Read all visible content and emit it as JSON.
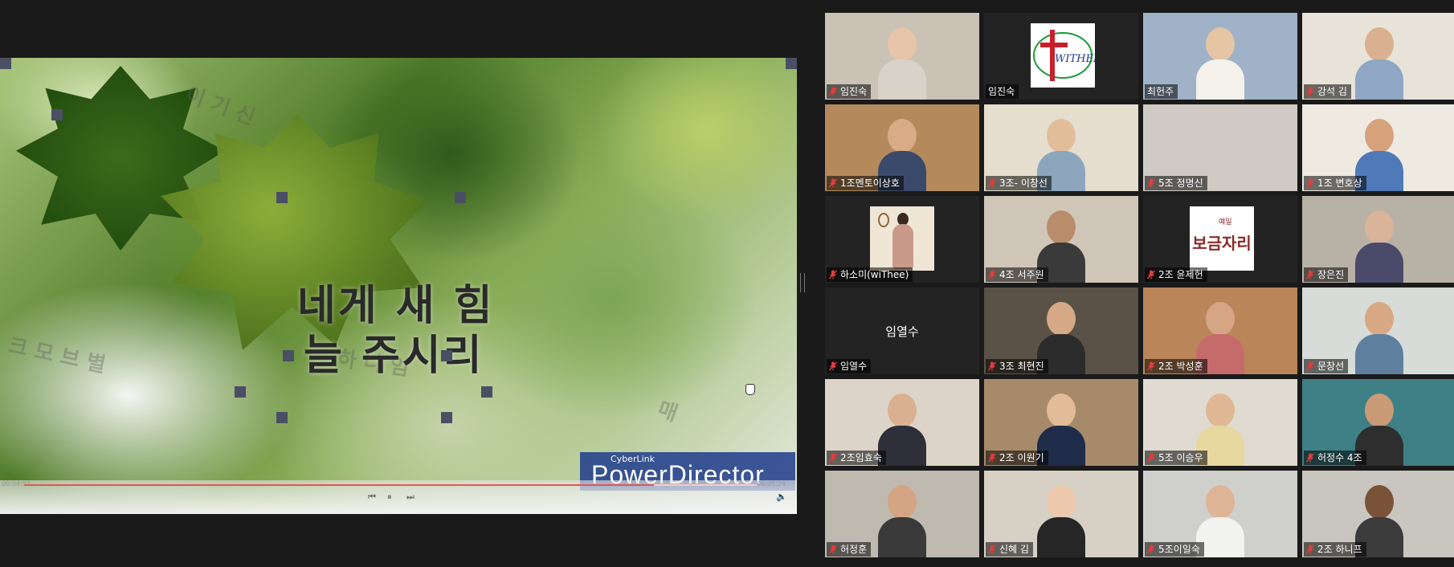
{
  "slide": {
    "title_line1": "네게 새 힘",
    "title_line2": "늘 주시리",
    "watermark_small": "CyberLink",
    "watermark_big": "PowerDirector",
    "player": {
      "progress": 0.86,
      "time_current": "00:04:57",
      "time_total": "00:05:24",
      "prev_icon": "⏮",
      "pause_icon": "⏸",
      "next_icon": "⏭",
      "volume_icon": "🔈"
    }
  },
  "colors": {
    "mute": "#e23c3c",
    "label_bg": "rgba(0,0,0,0.55)",
    "tile_bg": "#232323"
  },
  "participants": [
    {
      "name": "임진숙",
      "muted": true,
      "bg": "#c9c2b5",
      "skin": "#e8c4a8",
      "shirt": "#d9d2c8",
      "kind": "video"
    },
    {
      "name": "임진숙",
      "muted": false,
      "bg": "#232323",
      "kind": "logo-withee"
    },
    {
      "name": "최헌주",
      "muted": false,
      "bg": "#9fb2c8",
      "skin": "#e6c5a4",
      "shirt": "#f3f1ea",
      "kind": "video"
    },
    {
      "name": "강석 김",
      "muted": true,
      "bg": "#e7e3d8",
      "skin": "#d9b090",
      "shirt": "#8fa7c4",
      "kind": "video"
    },
    {
      "name": "1조멘토이상호",
      "muted": true,
      "bg": "#b48a5c",
      "skin": "#d9ab86",
      "shirt": "#3b4a6b",
      "kind": "video"
    },
    {
      "name": "3조- 이창선",
      "muted": true,
      "bg": "#e5ddcd",
      "skin": "#e2bd9a",
      "shirt": "#8da6bd",
      "kind": "video"
    },
    {
      "name": "5조 정명신",
      "muted": true,
      "bg": "#cfcbc4",
      "skin": "#cfcbc4",
      "shirt": "#cfcbc4",
      "kind": "video"
    },
    {
      "name": "1조 변호상",
      "muted": true,
      "bg": "#eeeae2",
      "skin": "#d5a27c",
      "shirt": "#4f79b8",
      "kind": "video"
    },
    {
      "name": "하소미(wiThee)",
      "muted": true,
      "bg": "#232323",
      "kind": "photo"
    },
    {
      "name": "4조 서주원",
      "muted": true,
      "bg": "#cfc6b8",
      "skin": "#b98d6c",
      "shirt": "#3a3a3a",
      "kind": "video"
    },
    {
      "name": "2조 윤제헌",
      "muted": true,
      "bg": "#232323",
      "kind": "logo-bogeum"
    },
    {
      "name": "장은진",
      "muted": true,
      "bg": "#b8b2a6",
      "skin": "#d9b49a",
      "shirt": "#4a4a6a",
      "kind": "video"
    },
    {
      "name": "임열수",
      "muted": true,
      "bg": "#232323",
      "kind": "text",
      "center": "임열수"
    },
    {
      "name": "3조 최현진",
      "muted": true,
      "bg": "#5a5246",
      "skin": "#d6a987",
      "shirt": "#2c2c2c",
      "kind": "video"
    },
    {
      "name": "2조 박성훈",
      "muted": true,
      "bg": "#b98559",
      "skin": "#d6a583",
      "shirt": "#c56b6b",
      "kind": "video"
    },
    {
      "name": "문창선",
      "muted": true,
      "bg": "#d8dcd8",
      "skin": "#d9a884",
      "shirt": "#5f7f9e",
      "kind": "video"
    },
    {
      "name": "2조임효숙",
      "muted": true,
      "bg": "#dcd4c8",
      "skin": "#d9b090",
      "shirt": "#2f2f3a",
      "kind": "video"
    },
    {
      "name": "2조 이원기",
      "muted": true,
      "bg": "#a68a6a",
      "skin": "#e2bb98",
      "shirt": "#1f2c4a",
      "kind": "video"
    },
    {
      "name": "5조 이승우",
      "muted": true,
      "bg": "#e0dbd0",
      "skin": "#e0b896",
      "shirt": "#e7d8a0",
      "kind": "video"
    },
    {
      "name": "허정수 4조",
      "muted": true,
      "bg": "#3f7f86",
      "skin": "#c99a76",
      "shirt": "#2e2e2e",
      "kind": "video"
    },
    {
      "name": "허정훈",
      "muted": true,
      "bg": "#bfbab0",
      "skin": "#d3a583",
      "shirt": "#3a3a3a",
      "kind": "video"
    },
    {
      "name": "신혜 김",
      "muted": true,
      "bg": "#d7d0c5",
      "skin": "#ecc9ad",
      "shirt": "#262626",
      "kind": "video"
    },
    {
      "name": "5조이일숙",
      "muted": true,
      "bg": "#cfd0cb",
      "skin": "#deb496",
      "shirt": "#f2f2ee",
      "kind": "video"
    },
    {
      "name": "2조 하니프",
      "muted": true,
      "bg": "#c9c6bf",
      "skin": "#7a5238",
      "shirt": "#3b3b3b",
      "kind": "video"
    }
  ],
  "logos": {
    "withee_text": "WITHEE",
    "bogeum_small": "예일",
    "bogeum_big": "보금자리"
  }
}
